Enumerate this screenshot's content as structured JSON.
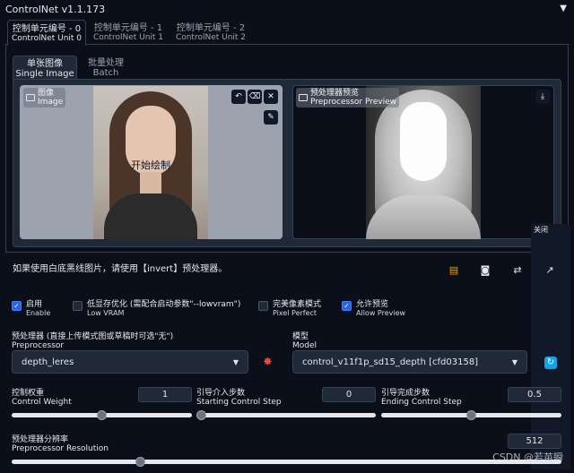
{
  "panel": {
    "title": "ControlNet v1.1.173",
    "collapse_icon": "triangle-down-icon"
  },
  "unit_tabs": [
    {
      "zh": "控制单元编号 - 0",
      "en": "ControlNet Unit 0"
    },
    {
      "zh": "控制单元编号 - 1",
      "en": "ControlNet Unit 1"
    },
    {
      "zh": "控制单元编号 - 2",
      "en": "ControlNet Unit 2"
    }
  ],
  "mode_tabs": [
    {
      "zh": "单张图像",
      "en": "Single Image"
    },
    {
      "zh": "批量处理",
      "en": "Batch"
    }
  ],
  "image_box": {
    "label_zh": "图像",
    "label_en": "Image",
    "overlay_text": "开始绘制"
  },
  "preview_box": {
    "label_zh": "预处理器预览",
    "label_en": "Preprocessor Preview",
    "close_label": "关闭"
  },
  "hint": "如果使用白底黑线图片，请使用【invert】预处理器。",
  "checkboxes": [
    {
      "zh": "启用",
      "en": "Enable",
      "checked": true
    },
    {
      "zh": "低显存优化 (需配合启动参数\"--lowvram\")",
      "en": "Low VRAM",
      "checked": false
    },
    {
      "zh": "完美像素模式",
      "en": "Pixel Perfect",
      "checked": false
    },
    {
      "zh": "允许预览",
      "en": "Allow Preview",
      "checked": true
    }
  ],
  "preprocessor": {
    "label_zh": "预处理器 (直接上传模式图或草稿时可选\"无\")",
    "label_en": "Preprocessor",
    "value": "depth_leres"
  },
  "model": {
    "label_zh": "模型",
    "label_en": "Model",
    "value": "control_v11f1p_sd15_depth [cfd03158]"
  },
  "sliders": {
    "control_weight": {
      "zh": "控制权重",
      "en": "Control Weight",
      "value": "1",
      "fraction": 0.5
    },
    "start_step": {
      "zh": "引导介入步数",
      "en": "Starting Control Step",
      "value": "0",
      "fraction": 0.0
    },
    "end_step": {
      "zh": "引导完成步数",
      "en": "Ending Control Step",
      "value": "0.5",
      "fraction": 0.5
    },
    "resolution": {
      "zh": "预处理器分辨率",
      "en": "Preprocessor Resolution",
      "value": "512",
      "fraction": 0.23
    }
  },
  "watermark": "CSDN @若苗瞬"
}
